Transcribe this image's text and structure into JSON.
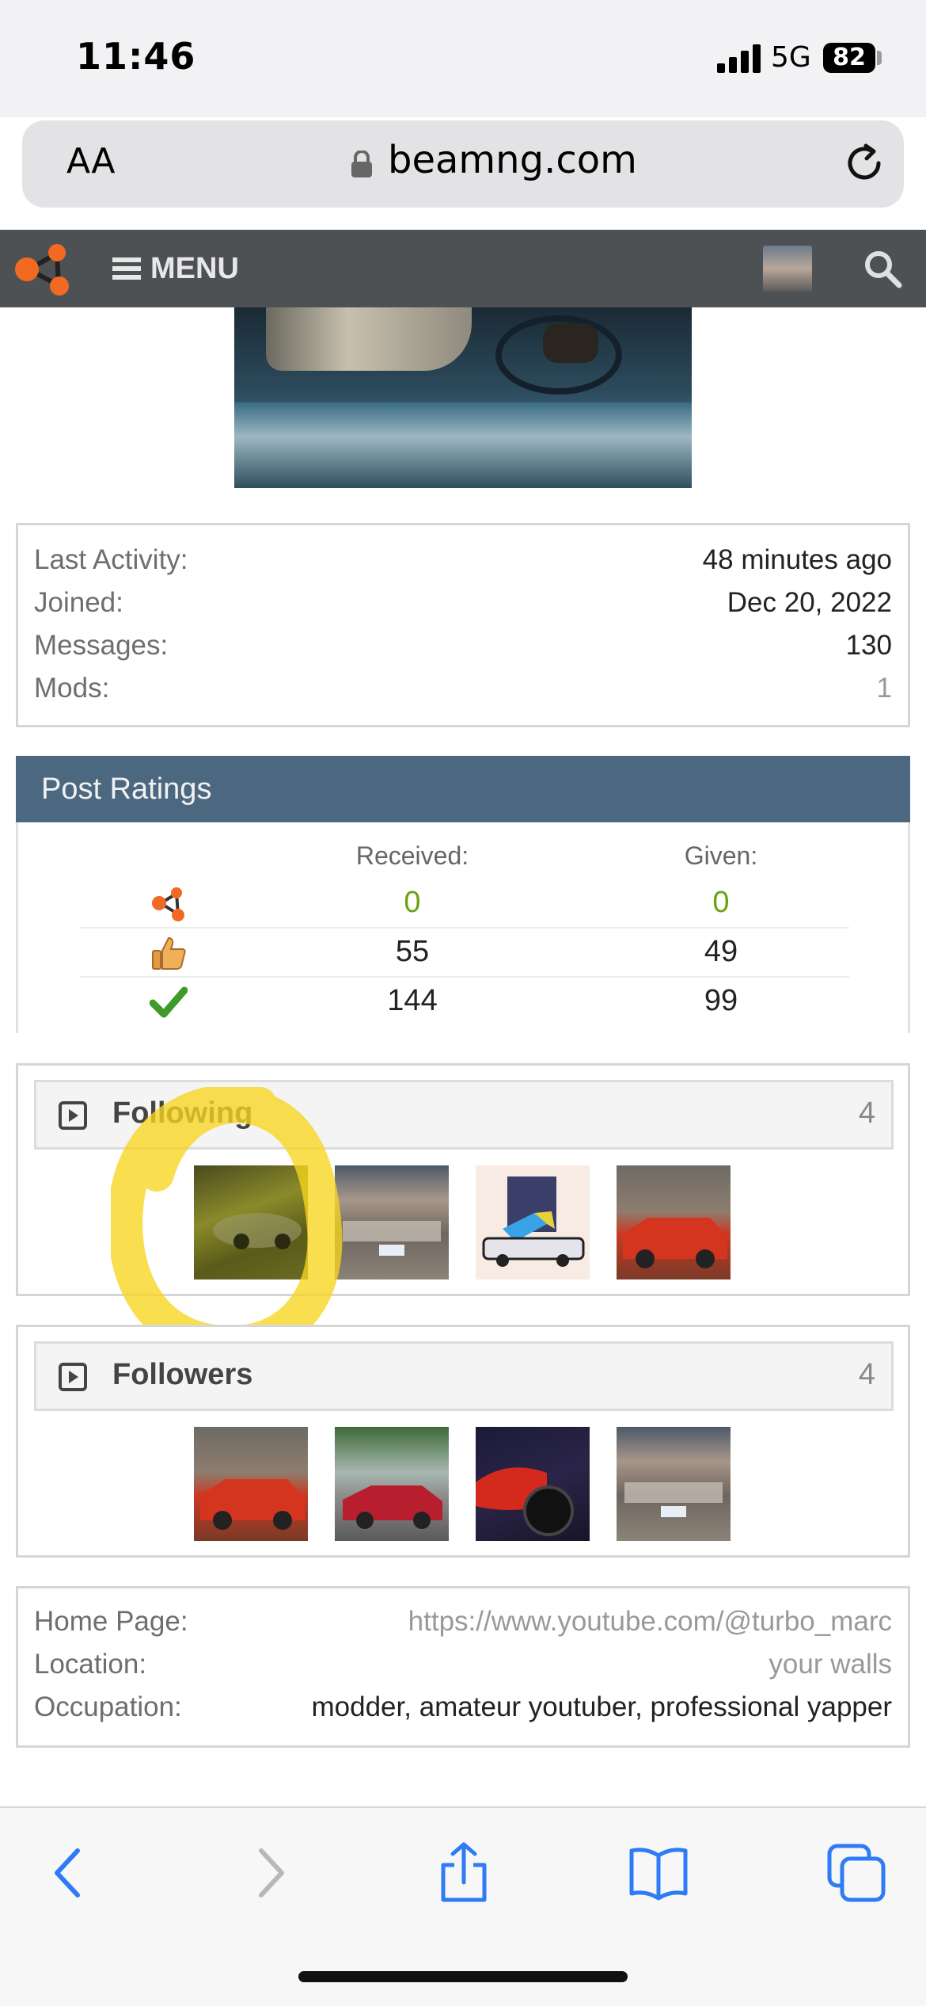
{
  "status_bar": {
    "time": "11:46",
    "network": "5G",
    "battery": "82"
  },
  "browser": {
    "text_size_label": "AA",
    "url": "beamng.com"
  },
  "nav": {
    "menu_label": "MENU"
  },
  "stats": [
    {
      "label": "Last Activity:",
      "value": "48 minutes ago"
    },
    {
      "label": "Joined:",
      "value": "Dec 20, 2022"
    },
    {
      "label": "Messages:",
      "value": "130"
    },
    {
      "label": "Mods:",
      "value": "1"
    }
  ],
  "post_ratings": {
    "title": "Post Ratings",
    "received_label": "Received:",
    "given_label": "Given:",
    "rows": [
      {
        "icon": "beamng-logo-icon",
        "received": "0",
        "given": "0"
      },
      {
        "icon": "thumbs-up-icon",
        "received": "55",
        "given": "49"
      },
      {
        "icon": "checkmark-icon",
        "received": "144",
        "given": "99"
      }
    ]
  },
  "following": {
    "title": "Following",
    "count": "4"
  },
  "followers": {
    "title": "Followers",
    "count": "4"
  },
  "details": [
    {
      "label": "Home Page:",
      "value": "https://www.youtube.com/@turbo_marc"
    },
    {
      "label": "Location:",
      "value": "your walls"
    },
    {
      "label": "Occupation:",
      "value": "modder, amateur youtuber, professional yapper"
    }
  ],
  "colors": {
    "nav_bar": "#4e5154",
    "ratings_header": "#4b6880",
    "rating_zero_green": "#6aa312",
    "ios_blue": "#2f7bf6",
    "highlight_yellow": "#f7d51d"
  }
}
